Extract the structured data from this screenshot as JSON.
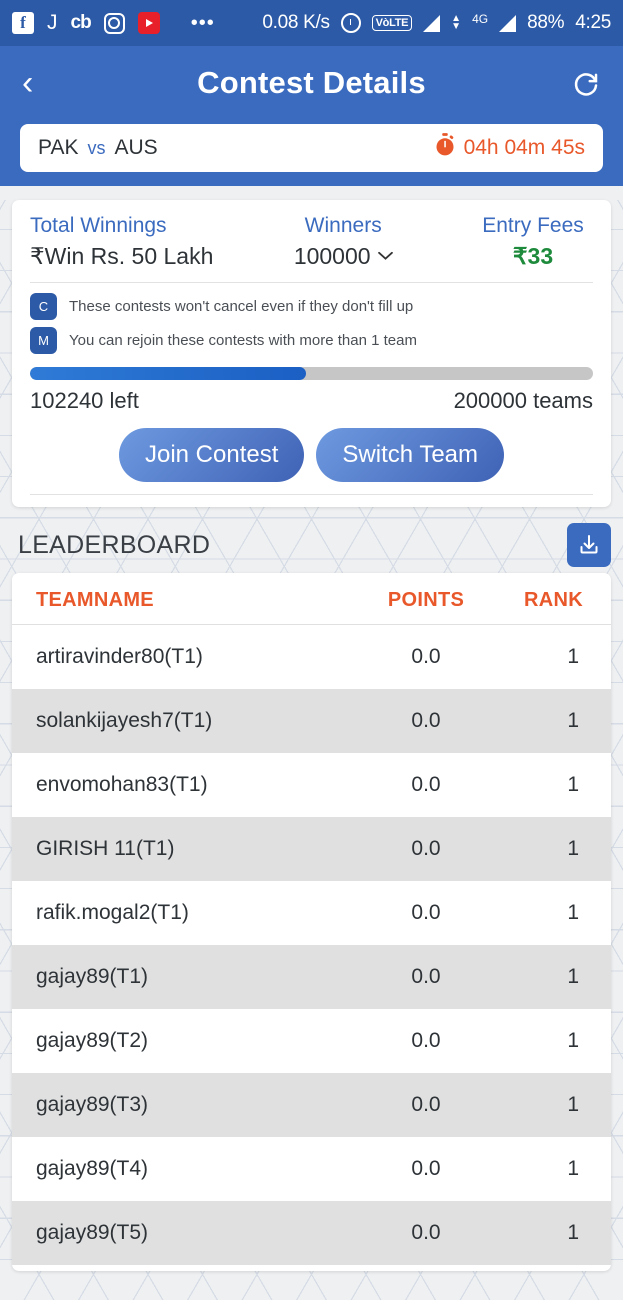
{
  "status_bar": {
    "app_icons": [
      "facebook-icon",
      "j-icon",
      "cb-icon",
      "instagram-icon",
      "youtube-icon"
    ],
    "overflow": "•••",
    "net_speed": "0.08 K/s",
    "volte": "VòLTE",
    "network_type": "4G",
    "battery": "88%",
    "time": "4:25"
  },
  "header": {
    "title": "Contest Details",
    "back_icon": "‹",
    "refresh_icon": "refresh-icon"
  },
  "match": {
    "team_a": "PAK",
    "vs": "vs",
    "team_b": "AUS",
    "timer": "04h 04m 45s",
    "timer_icon": "stopwatch-icon",
    "timer_color": "#e8582a"
  },
  "contest": {
    "total_winnings_label": "Total Winnings",
    "total_winnings_value": "₹Win Rs. 50 Lakh",
    "winners_label": "Winners",
    "winners_value": "100000",
    "winners_chevron": "⌄",
    "entry_fees_label": "Entry Fees",
    "entry_fees_value": "₹33",
    "entry_fees_color": "#1e8a3c",
    "notes": [
      {
        "badge": "C",
        "text": "These contests won't cancel even if they don't fill up"
      },
      {
        "badge": "M",
        "text": "You can rejoin these contests with more than 1 team"
      }
    ],
    "progress_percent": 49,
    "spots_left": "102240 left",
    "total_teams": "200000 teams",
    "join_button": "Join Contest",
    "switch_button": "Switch Team"
  },
  "leaderboard": {
    "title": "LEADERBOARD",
    "download_icon": "download-icon",
    "columns": [
      "TEAMNAME",
      "POINTS",
      "RANK"
    ],
    "rows": [
      {
        "team": "artiravinder80(T1)",
        "points": "0.0",
        "rank": "1"
      },
      {
        "team": "solankijayesh7(T1)",
        "points": "0.0",
        "rank": "1"
      },
      {
        "team": "envomohan83(T1)",
        "points": "0.0",
        "rank": "1"
      },
      {
        "team": "GIRISH 11(T1)",
        "points": "0.0",
        "rank": "1"
      },
      {
        "team": "rafik.mogal2(T1)",
        "points": "0.0",
        "rank": "1"
      },
      {
        "team": "gajay89(T1)",
        "points": "0.0",
        "rank": "1"
      },
      {
        "team": "gajay89(T2)",
        "points": "0.0",
        "rank": "1"
      },
      {
        "team": "gajay89(T3)",
        "points": "0.0",
        "rank": "1"
      },
      {
        "team": "gajay89(T4)",
        "points": "0.0",
        "rank": "1"
      },
      {
        "team": "gajay89(T5)",
        "points": "0.0",
        "rank": "1"
      }
    ]
  },
  "colors": {
    "status_bar_bg": "#2c5aa6",
    "header_bg": "#3b6bbf",
    "accent_orange": "#e8582a",
    "accent_blue": "#3b6bbf",
    "accent_green": "#1e8a3c"
  }
}
